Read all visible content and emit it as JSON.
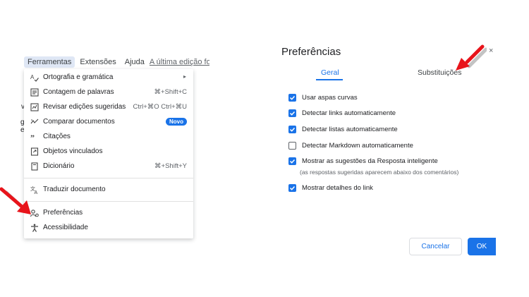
{
  "menubar": {
    "items": [
      "Ferramentas",
      "Extensões",
      "Ajuda"
    ],
    "last_edit": "A última edição foi f"
  },
  "doc_fragments": [
    "v",
    "g",
    "e"
  ],
  "tools_menu": {
    "items": [
      {
        "label": "Ortografia e gramática",
        "shortcut": "",
        "icon": "spellcheck-icon"
      },
      {
        "label": "Contagem de palavras",
        "shortcut": "⌘+Shift+C",
        "icon": "word-count-icon"
      },
      {
        "label": "Revisar edições sugeridas",
        "shortcut": "Ctrl+⌘O Ctrl+⌘U",
        "icon": "review-edits-icon"
      },
      {
        "label": "Comparar documentos",
        "badge": "Novo",
        "icon": "compare-icon"
      },
      {
        "label": "Citações",
        "shortcut": "",
        "icon": "quote-icon"
      },
      {
        "label": "Objetos vinculados",
        "shortcut": "",
        "icon": "linked-objects-icon"
      },
      {
        "label": "Dicionário",
        "shortcut": "⌘+Shift+Y",
        "icon": "dictionary-icon"
      },
      {
        "label": "Traduzir documento",
        "shortcut": "",
        "icon": "translate-icon"
      },
      {
        "label": "Preferências",
        "shortcut": "",
        "icon": "preferences-icon"
      },
      {
        "label": "Acessibilidade",
        "shortcut": "",
        "icon": "accessibility-icon"
      }
    ],
    "submenu_glyph": "▸"
  },
  "dialog": {
    "title": "Preferências",
    "close_glyph": "×",
    "tabs": [
      "Geral",
      "Substituições"
    ],
    "options": [
      {
        "label": "Usar aspas curvas",
        "checked": true
      },
      {
        "label": "Detectar links automaticamente",
        "checked": true
      },
      {
        "label": "Detectar listas automaticamente",
        "checked": true
      },
      {
        "label": "Detectar Markdown automaticamente",
        "checked": false
      },
      {
        "label": "Mostrar as sugestões da Resposta inteligente",
        "checked": true
      },
      {
        "label": "Mostrar detalhes do link",
        "checked": true
      }
    ],
    "option_note": "(as respostas sugeridas aparecem abaixo dos comentários)",
    "cancel_label": "Cancelar",
    "ok_label": "OK"
  },
  "colors": {
    "accent": "#1a73e8",
    "arrow": "#e8141b"
  }
}
